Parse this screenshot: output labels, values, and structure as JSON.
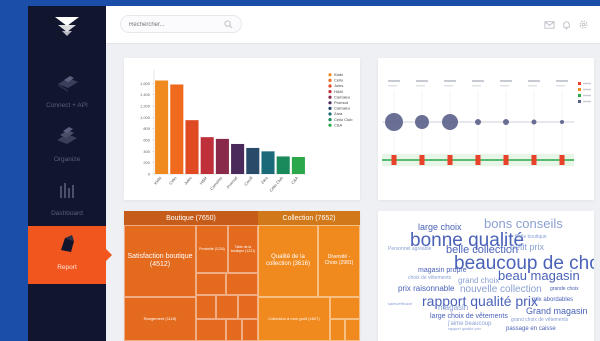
{
  "colors": {
    "accent": "#f0561e",
    "sidebar_bg": "#12152e",
    "frame_bg": "#eef0f4",
    "treemap_left": "#e46a1e",
    "treemap_right": "#f08a1e",
    "cloud_blue": "#4a62b8",
    "cloud_light": "#8aa0d4"
  },
  "sidebar": {
    "logo_icon": "funnel-logo-icon",
    "items": [
      {
        "label": "Connect + API",
        "icon": "database-icon",
        "active": false
      },
      {
        "label": "Organize",
        "icon": "layers-icon",
        "active": false
      },
      {
        "label": "Dashboard",
        "icon": "dashboard-icon",
        "active": false
      },
      {
        "label": "Report",
        "icon": "report-icon",
        "active": true
      }
    ]
  },
  "topbar": {
    "search_placeholder": "Rechercher...",
    "icons": [
      "mail-icon",
      "bell-icon",
      "settings-icon"
    ]
  },
  "chart_data": [
    {
      "type": "bar",
      "title": "",
      "categories": [
        "Kiabi",
        "Celio",
        "Jules",
        "H&M",
        "Camaïeu",
        "Promod",
        "Caroll",
        "Zara",
        "Celio Club",
        "C&A"
      ],
      "values": [
        1650,
        1580,
        950,
        650,
        620,
        530,
        460,
        400,
        310,
        300
      ],
      "colors": [
        "#f08a1e",
        "#f06a1e",
        "#e04a22",
        "#c0303a",
        "#8a2a4a",
        "#4a2a5a",
        "#2a4a6a",
        "#1a6a7a",
        "#1a8a5a",
        "#2aa84a"
      ],
      "ylim": [
        0,
        1800
      ],
      "yticks": [
        "1,600",
        "1,400",
        "1,200",
        "1,000",
        "800",
        "600",
        "400",
        "200",
        "0"
      ],
      "legend": [
        "Kiabi",
        "Celio",
        "Jules",
        "H&M",
        "Camaieu",
        "Promod",
        "Camaieu",
        "Zara",
        "Celio Club",
        "C&A"
      ],
      "legend_position": "right"
    }
  ],
  "treemap": {
    "left_header": "Boutique (7650)",
    "right_header": "Collection (7652)",
    "tiles": [
      {
        "label": "Satisfaction boutique (4512)"
      },
      {
        "label": "Proximité (1234)"
      },
      {
        "label": "Taille de la boutique (1221)"
      },
      {
        "label": "Rangement (1118)"
      },
      {
        "label": "Qualité de la collection (3616)"
      },
      {
        "label": "Diversité - Choix (2981)"
      },
      {
        "label": "Collection à mon goût (1827)"
      }
    ]
  },
  "wordcloud": [
    {
      "text": "bons conseils",
      "size": 13,
      "color": "#8aa0d4"
    },
    {
      "text": "large choix",
      "size": 9,
      "color": "#4a62b8"
    },
    {
      "text": "bonne qualité",
      "size": 19,
      "color": "#4a62b8"
    },
    {
      "text": "Belle boutique",
      "size": 5,
      "color": "#8aa0d4"
    },
    {
      "text": "belle collection",
      "size": 11,
      "color": "#4a62b8"
    },
    {
      "text": "petit prix",
      "size": 9,
      "color": "#8aa0d4"
    },
    {
      "text": "Personnel agréable",
      "size": 5,
      "color": "#8aa0d4"
    },
    {
      "text": "beaucoup de choix",
      "size": 19,
      "color": "#4a62b8"
    },
    {
      "text": "magasin propre",
      "size": 7,
      "color": "#4a62b8"
    },
    {
      "text": "beau magasin",
      "size": 13,
      "color": "#4a62b8"
    },
    {
      "text": "choix de vêtements",
      "size": 5,
      "color": "#8aa0d4"
    },
    {
      "text": "grand choix",
      "size": 8,
      "color": "#8aa0d4"
    },
    {
      "text": "prix raisonnable",
      "size": 8,
      "color": "#4a62b8"
    },
    {
      "text": "nouvelle collection",
      "size": 10,
      "color": "#8aa0d4"
    },
    {
      "text": "grande choix",
      "size": 5,
      "color": "#4a62b8"
    },
    {
      "text": "rapport qualité prix",
      "size": 14,
      "color": "#4a62b8"
    },
    {
      "text": "prix abordables",
      "size": 6,
      "color": "#4a62b8"
    },
    {
      "text": "sales/efficace",
      "size": 4,
      "color": "#8aa0d4"
    },
    {
      "text": "magasin",
      "size": 8,
      "color": "#8aa0d4"
    },
    {
      "text": "Grand magasin",
      "size": 9,
      "color": "#4a62b8"
    },
    {
      "text": "large choix de vêtements",
      "size": 7,
      "color": "#4a62b8"
    },
    {
      "text": "grand choix de vêtements",
      "size": 5,
      "color": "#8aa0d4"
    },
    {
      "text": "j'aime beaucoup",
      "size": 6,
      "color": "#8aa0d4"
    },
    {
      "text": "rapport qualité prix",
      "size": 4,
      "color": "#8aa0d4"
    },
    {
      "text": "passage en caisse",
      "size": 6,
      "color": "#4a62b8"
    }
  ]
}
